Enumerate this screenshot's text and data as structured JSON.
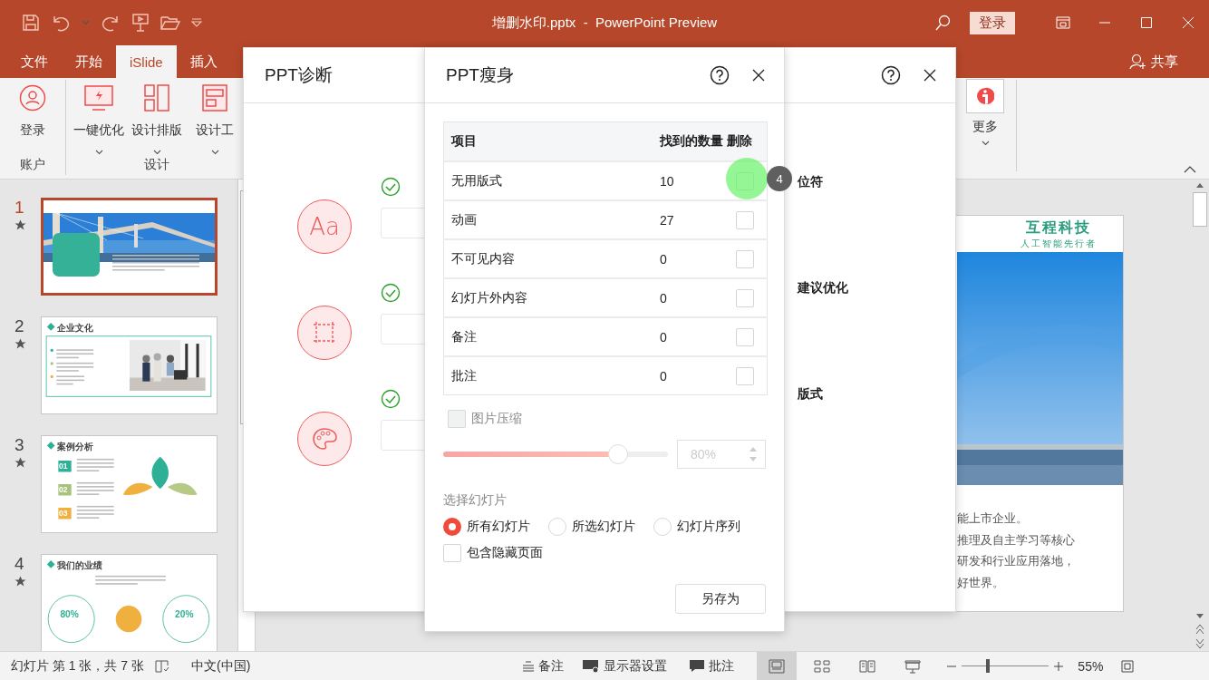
{
  "title_bar": {
    "document_title": "增删水印.pptx  -  PowerPoint Preview",
    "sign_in": "登录"
  },
  "ribbon_tabs": [
    {
      "label": "文件",
      "selected": false
    },
    {
      "label": "开始",
      "selected": false
    },
    {
      "label": "iSlide",
      "selected": true
    },
    {
      "label": "插入",
      "selected": false
    }
  ],
  "share": "共享",
  "ribbon": {
    "groups": [
      {
        "label": "账户",
        "buttons": [
          {
            "label": "登录",
            "kind": "user",
            "dropdown": false
          }
        ]
      },
      {
        "label": "设计",
        "buttons": [
          {
            "label": "一键优化",
            "kind": "optimize",
            "dropdown": true
          },
          {
            "label": "设计排版",
            "kind": "layout",
            "dropdown": true
          },
          {
            "label": "设计工",
            "kind": "tools",
            "dropdown": true
          }
        ]
      }
    ],
    "more": {
      "label": "更多",
      "dropdown": true
    }
  },
  "slides": [
    {
      "number": "1",
      "selected": true,
      "animated": true,
      "kind": "cover"
    },
    {
      "number": "2",
      "selected": false,
      "animated": true,
      "kind": "culture",
      "heading": "企业文化"
    },
    {
      "number": "3",
      "selected": false,
      "animated": true,
      "kind": "cases",
      "heading": "案例分析",
      "badges": [
        "01",
        "02",
        "03"
      ]
    },
    {
      "number": "4",
      "selected": false,
      "animated": true,
      "kind": "results",
      "heading": "我们的业绩",
      "figures": [
        "80%",
        "20%"
      ]
    }
  ],
  "slide": {
    "logo": "互程科技",
    "tagline": "人工智能先行者",
    "text_lines": [
      "能上市企业。",
      "推理及自主学习等核心",
      "研发和行业应用落地，",
      "好世界。"
    ]
  },
  "diagnosis_dialog": {
    "title": "PPT诊断",
    "rows": [
      {
        "kind": "font",
        "icon_text": "Aa",
        "passed": true,
        "result": "位符"
      },
      {
        "kind": "frame",
        "passed": true,
        "result": "建议优化"
      },
      {
        "kind": "palette",
        "passed": true,
        "result": "版式"
      }
    ]
  },
  "slim_dialog": {
    "title": "PPT瘦身",
    "columns": [
      "项目",
      "找到的数量",
      "删除"
    ],
    "rows": [
      {
        "item": "无用版式",
        "count": "10",
        "checked": false
      },
      {
        "item": "动画",
        "count": "27",
        "checked": false
      },
      {
        "item": "不可见内容",
        "count": "0",
        "checked": false
      },
      {
        "item": "幻灯片外内容",
        "count": "0",
        "checked": false
      },
      {
        "item": "备注",
        "count": "0",
        "checked": false
      },
      {
        "item": "批注",
        "count": "0",
        "checked": false
      }
    ],
    "compress": {
      "label": "图片压缩",
      "checked": false,
      "disabled": true,
      "level": 0.78,
      "value": "80%"
    },
    "select_label": "选择幻灯片",
    "scope": [
      {
        "label": "所有幻灯片",
        "selected": true
      },
      {
        "label": "所选幻灯片",
        "selected": false
      },
      {
        "label": "幻灯片序列",
        "selected": false
      }
    ],
    "include_hidden": {
      "label": "包含隐藏页面",
      "checked": false
    },
    "save_as": "另存为"
  },
  "click_marker": {
    "label": "4"
  },
  "status_bar": {
    "slide_info": "幻灯片 第 1 张，共 7 张",
    "language": "中文(中国)",
    "notes": "备注",
    "display_settings": "显示器设置",
    "comments": "批注",
    "views": [
      {
        "kind": "normal",
        "selected": true
      },
      {
        "kind": "sorter",
        "selected": false
      },
      {
        "kind": "reading",
        "selected": false
      },
      {
        "kind": "show",
        "selected": false
      }
    ],
    "zoom": {
      "level": 0.3,
      "label": "55%"
    }
  }
}
